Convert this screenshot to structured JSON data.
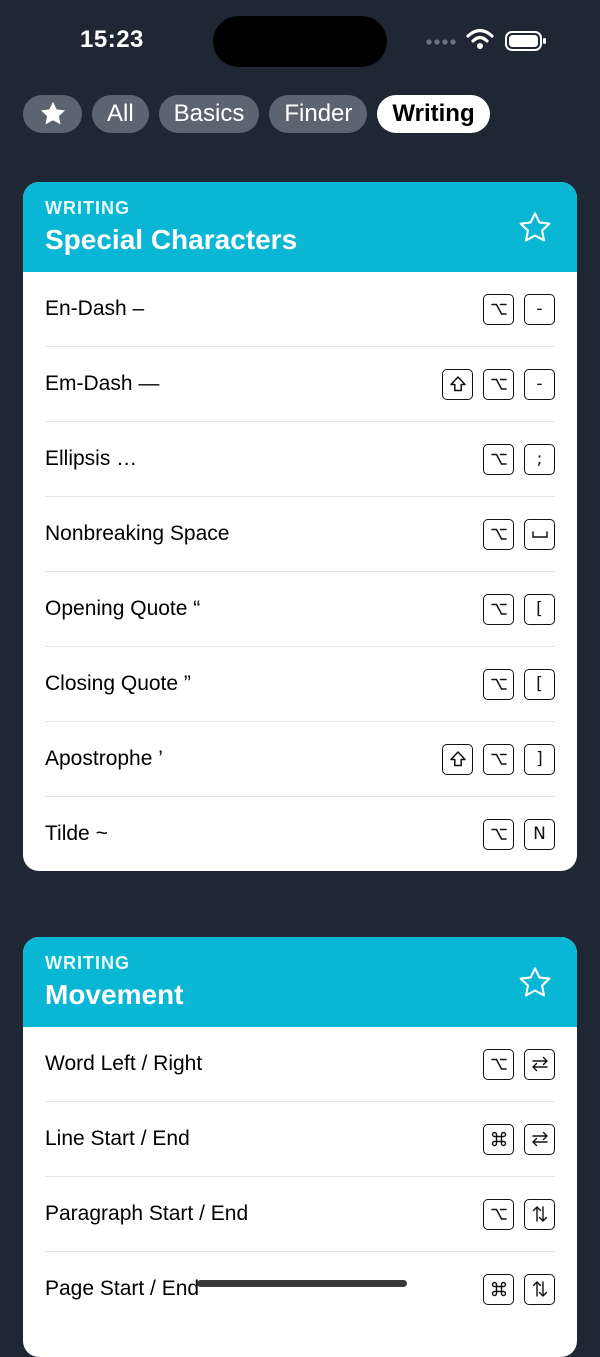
{
  "status": {
    "time": "15:23"
  },
  "filters": [
    {
      "label": "All"
    },
    {
      "label": "Basics"
    },
    {
      "label": "Finder"
    },
    {
      "label": "Writing"
    }
  ],
  "cards": [
    {
      "category": "WRITING",
      "title": "Special Characters",
      "rows": [
        {
          "label": "En-Dash –",
          "keys": [
            "option",
            "-"
          ]
        },
        {
          "label": "Em-Dash —",
          "keys": [
            "shift",
            "option",
            "-"
          ]
        },
        {
          "label": "Ellipsis …",
          "keys": [
            "option",
            ";"
          ]
        },
        {
          "label": "Nonbreaking Space",
          "keys": [
            "option",
            "space"
          ]
        },
        {
          "label": "Opening Quote “",
          "keys": [
            "option",
            "["
          ]
        },
        {
          "label": "Closing Quote ”",
          "keys": [
            "option",
            "["
          ]
        },
        {
          "label": "Apostrophe ’",
          "keys": [
            "shift",
            "option",
            "]"
          ]
        },
        {
          "label": "Tilde ~",
          "keys": [
            "option",
            "N"
          ]
        }
      ]
    },
    {
      "category": "WRITING",
      "title": "Movement",
      "rows": [
        {
          "label": "Word Left / Right",
          "keys": [
            "option",
            "left-right-arrows"
          ]
        },
        {
          "label": "Line Start / End",
          "keys": [
            "command",
            "left-right-arrows"
          ]
        },
        {
          "label": "Paragraph Start / End",
          "keys": [
            "option",
            "up-down-arrows"
          ]
        },
        {
          "label": "Page Start / End",
          "keys": [
            "command",
            "up-down-arrows"
          ]
        }
      ]
    }
  ]
}
